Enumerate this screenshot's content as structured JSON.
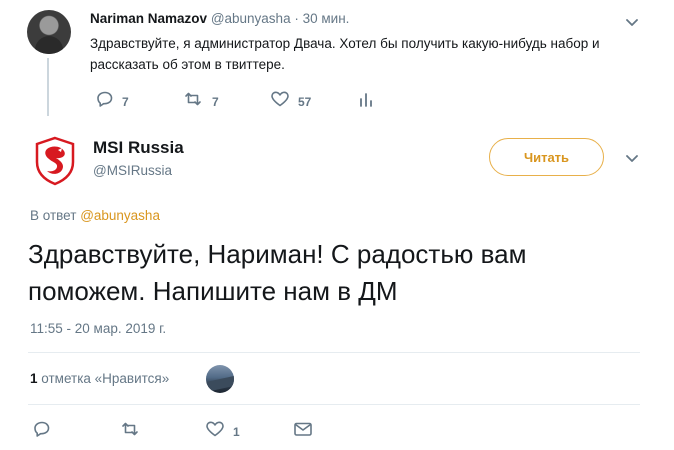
{
  "parent_tweet": {
    "author_name": "Nariman Namazov",
    "handle": "@abunyasha",
    "separator": "·",
    "time": "30 мин.",
    "text": "Здравствуйте, я администратор Двача. Хотел бы получить какую-нибудь набор и рассказать об этом в твиттере.",
    "actions": {
      "reply_icon": "reply-icon",
      "reply_count": "7",
      "retweet_icon": "retweet-icon",
      "retweet_count": "7",
      "like_icon": "heart-icon",
      "like_count": "57",
      "analytics_icon": "analytics-icon"
    }
  },
  "main_tweet": {
    "author_name": "MSI Russia",
    "handle": "@MSIRussia",
    "follow_label": "Читать",
    "reply_prefix": "В ответ",
    "reply_mention": "@abunyasha",
    "text": "Здравствуйте, Нариман! С радостью вам поможем. Напишите нам в ДМ",
    "timestamp": "11:55 - 20 мар. 2019 г.",
    "likes_count": "1",
    "likes_label": "отметка «Нравится»",
    "actions": {
      "reply_icon": "reply-icon",
      "retweet_icon": "retweet-icon",
      "like_icon": "heart-icon",
      "like_count": "1",
      "dm_icon": "envelope-icon"
    }
  },
  "colors": {
    "accent": "#d9961f",
    "follow_border": "#e8b04a",
    "secondary_text": "#657786",
    "icon": "#657786",
    "msi_red": "#d71920",
    "divider": "#e6ecf0"
  }
}
